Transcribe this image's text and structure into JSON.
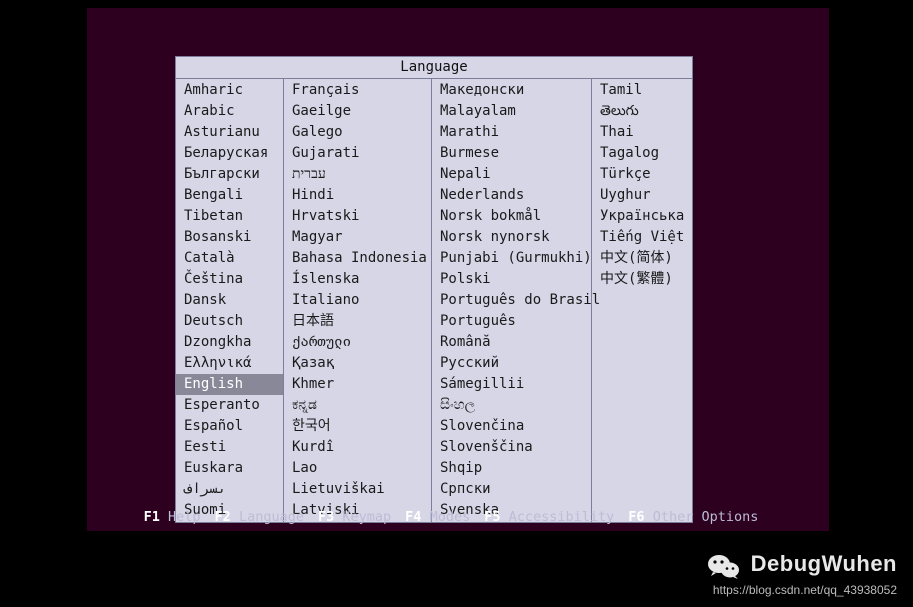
{
  "dialog": {
    "title": "Language",
    "columns": [
      [
        "Amharic",
        "Arabic",
        "Asturianu",
        "Беларуская",
        "Български",
        "Bengali",
        "Tibetan",
        "Bosanski",
        "Català",
        "Čeština",
        "Dansk",
        "Deutsch",
        "Dzongkha",
        "Ελληνικά",
        "English",
        "Esperanto",
        "Español",
        "Eesti",
        "Euskara",
        "ىسراف",
        "Suomi"
      ],
      [
        "Français",
        "Gaeilge",
        "Galego",
        "Gujarati",
        "עברית",
        "Hindi",
        "Hrvatski",
        "Magyar",
        "Bahasa Indonesia",
        "Íslenska",
        "Italiano",
        "日本語",
        "ქართული",
        "Қазақ",
        "Khmer",
        "ಕನ್ನಡ",
        "한국어",
        "Kurdî",
        "Lao",
        "Lietuviškai",
        "Latviski"
      ],
      [
        "Македонски",
        "Malayalam",
        "Marathi",
        "Burmese",
        "Nepali",
        "Nederlands",
        "Norsk bokmål",
        "Norsk nynorsk",
        "Punjabi (Gurmukhi)",
        "Polski",
        "Português do Brasil",
        "Português",
        "Română",
        "Русский",
        "Sámegillii",
        "සිංහල",
        "Slovenčina",
        "Slovenščina",
        "Shqip",
        "Српски",
        "Svenska"
      ],
      [
        "Tamil",
        "తెలుగు",
        "Thai",
        "Tagalog",
        "Türkçe",
        "Uyghur",
        "Українська",
        "Tiếng Việt",
        "中文(简体)",
        "中文(繁體)"
      ]
    ],
    "selected": "English"
  },
  "footer": {
    "keys": [
      {
        "key": "F1",
        "label": "Help"
      },
      {
        "key": "F2",
        "label": "Language"
      },
      {
        "key": "F3",
        "label": "Keymap"
      },
      {
        "key": "F4",
        "label": "Modes"
      },
      {
        "key": "F5",
        "label": "Accessibility"
      },
      {
        "key": "F6",
        "label": "Other Options"
      }
    ]
  },
  "watermark": {
    "name": "DebugWuhen",
    "url": "https://blog.csdn.net/qq_43938052"
  }
}
